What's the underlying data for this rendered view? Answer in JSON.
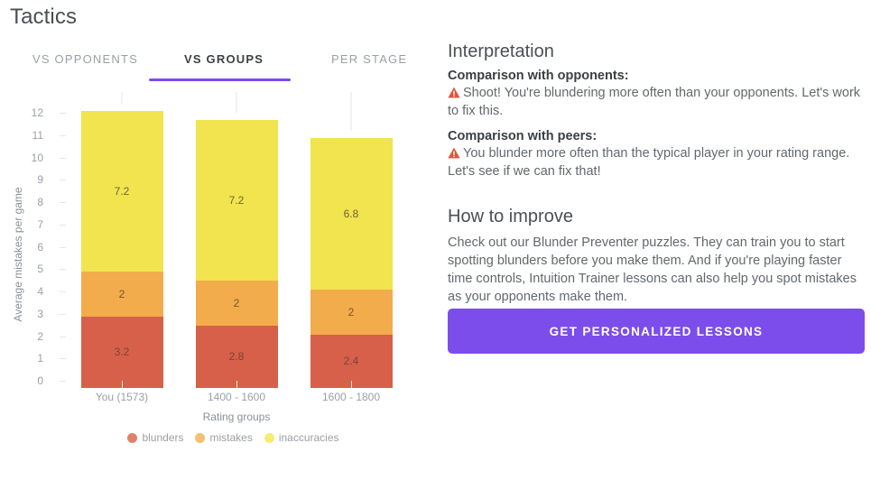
{
  "page_title": "Tactics",
  "tabs": [
    {
      "label": "VS OPPONENTS",
      "active": false
    },
    {
      "label": "VS GROUPS",
      "active": true
    },
    {
      "label": "PER STAGE",
      "active": false
    }
  ],
  "chart_data": {
    "type": "bar",
    "subtype": "stacked",
    "title": "",
    "xlabel": "Rating groups",
    "ylabel": "Average mistakes per game",
    "categories": [
      "You (1573)",
      "1400 - 1600",
      "1600 - 1800"
    ],
    "series": [
      {
        "name": "blunders",
        "color": "#d6604a",
        "values": [
          3.2,
          2.8,
          2.4
        ]
      },
      {
        "name": "mistakes",
        "color": "#f2ac4b",
        "values": [
          2,
          2,
          2
        ]
      },
      {
        "name": "inaccuracies",
        "color": "#f2e44e",
        "values": [
          7.2,
          7.2,
          6.8
        ]
      }
    ],
    "totals": [
      12.4,
      12.0,
      11.2
    ],
    "ylim": [
      0,
      12
    ],
    "yticks": [
      "12",
      "11",
      "10",
      "9",
      "8",
      "7",
      "6",
      "5",
      "4",
      "3",
      "2",
      "1",
      "0"
    ],
    "grid": false,
    "legend_position": "bottom"
  },
  "interpretation": {
    "heading": "Interpretation",
    "opponents_label": "Comparison with opponents:",
    "opponents_text": "Shoot! You're blundering more often than your opponents. Let's work to fix this.",
    "peers_label": "Comparison with peers:",
    "peers_text": "You blunder more often than the typical player in your rating range. Let's see if we can fix that!"
  },
  "improve": {
    "heading": "How to improve",
    "text": "Check out our Blunder Preventer puzzles. They can train you to start spotting blunders before you make them. And if you're playing faster time controls, Intuition Trainer lessons can also help you spot mistakes as your opponents make them."
  },
  "cta": {
    "label": "GET PERSONALIZED LESSONS",
    "color": "#7c4dea"
  },
  "accent_color": "#7c4dea",
  "warning_color": "#e2543a"
}
